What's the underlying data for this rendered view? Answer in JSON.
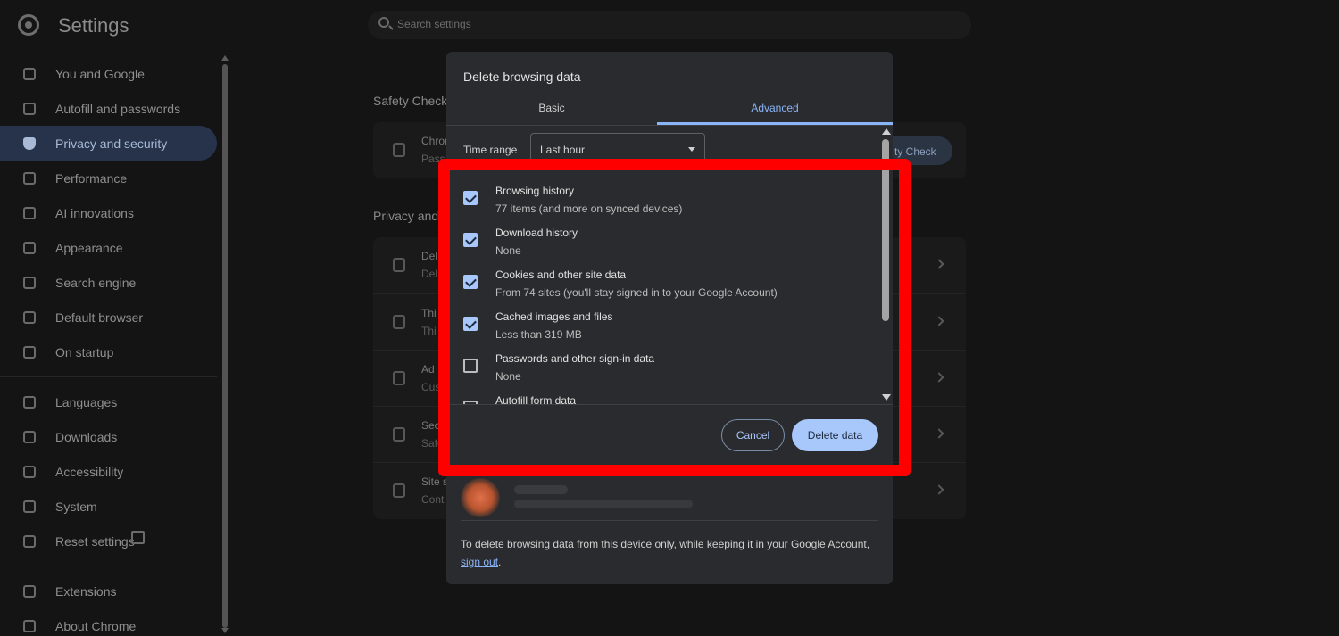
{
  "header": {
    "title": "Settings",
    "search_placeholder": "Search settings"
  },
  "sidebar": {
    "items": [
      {
        "label": "You and Google",
        "icon": "google-icon"
      },
      {
        "label": "Autofill and passwords",
        "icon": "key-icon"
      },
      {
        "label": "Privacy and security",
        "icon": "shield-icon",
        "active": true
      },
      {
        "label": "Performance",
        "icon": "speedometer-icon"
      },
      {
        "label": "AI innovations",
        "icon": "sparkle-icon"
      },
      {
        "label": "Appearance",
        "icon": "palette-icon"
      },
      {
        "label": "Search engine",
        "icon": "search-icon"
      },
      {
        "label": "Default browser",
        "icon": "browser-window-icon"
      },
      {
        "label": "On startup",
        "icon": "power-icon"
      },
      {
        "label": "Languages",
        "icon": "translate-icon"
      },
      {
        "label": "Downloads",
        "icon": "download-icon"
      },
      {
        "label": "Accessibility",
        "icon": "accessibility-icon"
      },
      {
        "label": "System",
        "icon": "wrench-icon"
      },
      {
        "label": "Reset settings",
        "icon": "reset-icon"
      },
      {
        "label": "Extensions",
        "icon": "puzzle-icon"
      },
      {
        "label": "About Chrome",
        "icon": "chrome-icon"
      }
    ]
  },
  "background": {
    "safety_check_title": "Safety Check",
    "safety_row_title": "Chron",
    "safety_row_sub": "Pass",
    "safety_button": "ty Check",
    "privacy_title": "Privacy and",
    "rows": [
      {
        "t1": "Del",
        "t2": "Del"
      },
      {
        "t1": "Thi",
        "t2": "Thi"
      },
      {
        "t1": "Ad",
        "t2": "Cus"
      },
      {
        "t1": "Sec",
        "t2": "Safe"
      },
      {
        "t1": "Site s",
        "t2": "Cont"
      }
    ]
  },
  "dialog": {
    "title": "Delete browsing data",
    "tabs": {
      "basic": "Basic",
      "advanced": "Advanced"
    },
    "time_range_label": "Time range",
    "time_range_value": "Last hour",
    "items": [
      {
        "title": "Browsing history",
        "subtitle": "77 items (and more on synced devices)",
        "checked": true
      },
      {
        "title": "Download history",
        "subtitle": "None",
        "checked": true
      },
      {
        "title": "Cookies and other site data",
        "subtitle": "From 74 sites (you'll stay signed in to your Google Account)",
        "checked": true
      },
      {
        "title": "Cached images and files",
        "subtitle": "Less than 319 MB",
        "checked": true
      },
      {
        "title": "Passwords and other sign-in data",
        "subtitle": "None",
        "checked": false
      },
      {
        "title": "Autofill form data",
        "subtitle": "",
        "checked": false
      }
    ],
    "cancel_label": "Cancel",
    "delete_label": "Delete data",
    "footer_text": "To delete browsing data from this device only, while keeping it in your Google Account,",
    "footer_link": "sign out",
    "footer_end": "."
  },
  "colors": {
    "highlight": "#ff0000",
    "accent": "#8ab4f8",
    "primary_button": "#a8c7fa"
  }
}
